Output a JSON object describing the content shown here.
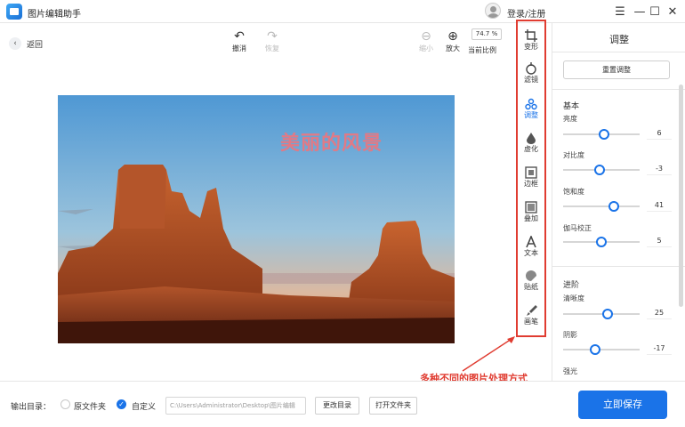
{
  "app": {
    "title": "图片编辑助手",
    "login_label": "登录/注册"
  },
  "window_controls": {
    "menu": "☰",
    "minimize": "—",
    "maximize": "☐",
    "close": "✕"
  },
  "nav": {
    "back_label": "返回"
  },
  "toolbar": {
    "undo_label": "撤消",
    "redo_label": "恢复",
    "zoom_out_label": "缩小",
    "zoom_in_label": "放大",
    "zoom_value": "74.7 %",
    "actual_ratio_label": "当前比例"
  },
  "canvas": {
    "overlay_text": "美丽的风景"
  },
  "tool_strip": {
    "items": [
      {
        "label": "变形",
        "icon": "crop-icon"
      },
      {
        "label": "滤镜",
        "icon": "filter-icon"
      },
      {
        "label": "调整",
        "icon": "adjust-icon",
        "active": true
      },
      {
        "label": "虚化",
        "icon": "blur-icon"
      },
      {
        "label": "边框",
        "icon": "frame-icon"
      },
      {
        "label": "叠加",
        "icon": "overlay-icon"
      },
      {
        "label": "文本",
        "icon": "text-icon"
      },
      {
        "label": "贴纸",
        "icon": "sticker-icon"
      },
      {
        "label": "画笔",
        "icon": "brush-icon"
      }
    ]
  },
  "panel": {
    "title": "调整",
    "reset_label": "重置调整",
    "basic": {
      "title": "基本",
      "sliders": [
        {
          "label": "亮度",
          "value": "6",
          "level": 0.53
        },
        {
          "label": "对比度",
          "value": "-3",
          "level": 0.48
        },
        {
          "label": "饱和度",
          "value": "41",
          "level": 0.66
        },
        {
          "label": "伽马校正",
          "value": "5",
          "level": 0.5
        }
      ]
    },
    "advanced": {
      "title": "进阶",
      "sliders": [
        {
          "label": "清晰度",
          "value": "25",
          "level": 0.58
        },
        {
          "label": "阴影",
          "value": "-17",
          "level": 0.42
        },
        {
          "label": "强光",
          "value": "",
          "level": 0.5
        }
      ]
    }
  },
  "annotation": {
    "text": "多种不同的图片处理方式",
    "color": "#e03c31"
  },
  "bottom": {
    "output_label": "输出目录：",
    "option_original": "原文件夹",
    "option_custom": "自定义",
    "path_value": "C:\\Users\\Administrator\\Desktop\\图片编辑",
    "change_dir_label": "更改目录",
    "open_folder_label": "打开文件夹",
    "save_label": "立即保存"
  },
  "colors": {
    "accent": "#1a73e8",
    "highlight": "#e03c31"
  }
}
